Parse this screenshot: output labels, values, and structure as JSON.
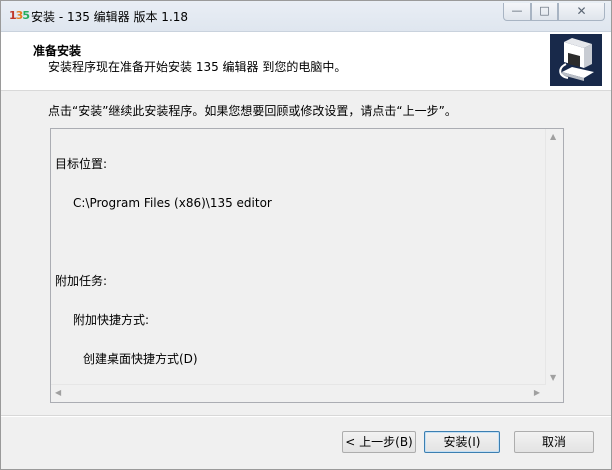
{
  "window": {
    "title": "安装 - 135 编辑器 版本 1.18",
    "icon": "installer-app-icon",
    "controls": {
      "minimize": "—",
      "maximize": "□",
      "close": "✕"
    }
  },
  "header": {
    "title": "准备安装",
    "description": "安装程序现在准备开始安装 135 编辑器 到您的电脑中。"
  },
  "instruction": "点击“安装”继续此安装程序。如果您想要回顾或修改设置，请点击“上一步”。",
  "memo": {
    "lines": [
      {
        "text": "目标位置:",
        "indent": 0
      },
      {
        "text": "C:\\Program Files (x86)\\135 editor",
        "indent": 1
      },
      {
        "text": "",
        "indent": 0
      },
      {
        "text": "附加任务:",
        "indent": 0
      },
      {
        "text": "附加快捷方式:",
        "indent": 1
      },
      {
        "text": "创建桌面快捷方式(D)",
        "indent": 2
      }
    ]
  },
  "buttons": {
    "back": "< 上一步(B)",
    "install": "安装(I)",
    "cancel": "取消"
  }
}
